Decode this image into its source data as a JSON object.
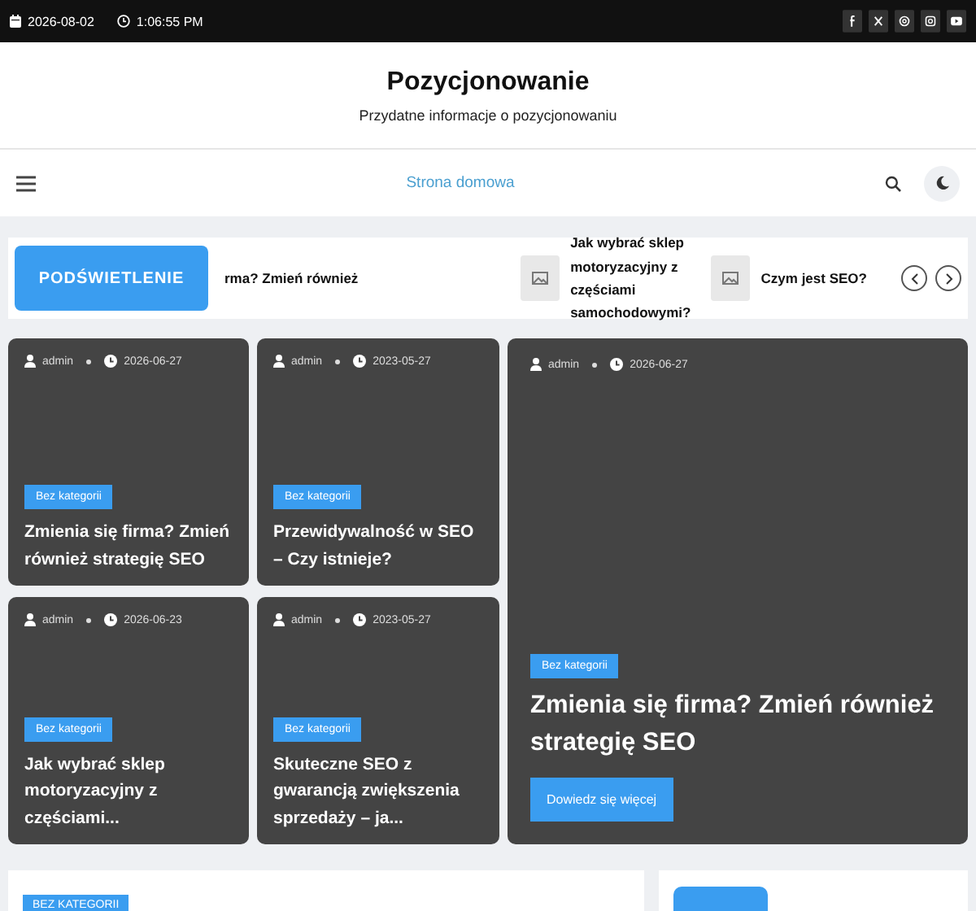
{
  "topbar": {
    "date": "2026-08-02",
    "time": "1:06:55 PM",
    "social": [
      {
        "kind": "facebook"
      },
      {
        "kind": "x"
      },
      {
        "kind": "threads"
      },
      {
        "kind": "instagram"
      },
      {
        "kind": "youtube"
      }
    ]
  },
  "header": {
    "title": "Pozycjonowanie",
    "tagline": "Przydatne informacje o pozycjonowaniu"
  },
  "nav": {
    "link": "Strona domowa"
  },
  "ticker": {
    "label": "PODŚWIETLENIE",
    "items": [
      {
        "title": "rma? Zmień również",
        "thumbnail": false
      },
      {
        "title": "Jak wybrać sklep motoryzacyjny z częściami samochodowymi?",
        "thumbnail": true
      },
      {
        "title": "Czym jest SEO?",
        "thumbnail": true
      }
    ]
  },
  "posts": [
    {
      "author": "admin",
      "date": "2026-06-27",
      "category": "Bez kategorii",
      "title": "Zmienia się firma? Zmień również strategię SEO"
    },
    {
      "author": "admin",
      "date": "2023-05-27",
      "category": "Bez kategorii",
      "title": "Przewidywalność w SEO – Czy istnieje?"
    },
    {
      "author": "admin",
      "date": "2026-06-23",
      "category": "Bez kategorii",
      "title": "Jak wybrać sklep motoryzacyjny z częściami..."
    },
    {
      "author": "admin",
      "date": "2023-05-27",
      "category": "Bez kategorii",
      "title": "Skuteczne SEO z gwarancją zwiększenia sprzedaży – ja..."
    }
  ],
  "featured": {
    "author": "admin",
    "date": "2026-06-27",
    "category": "Bez kategorii",
    "title": "Zmienia się firma? Zmień również strategię SEO",
    "button": "Dowiedz się więcej"
  },
  "bottom": {
    "category": "BEZ KATEGORII"
  }
}
